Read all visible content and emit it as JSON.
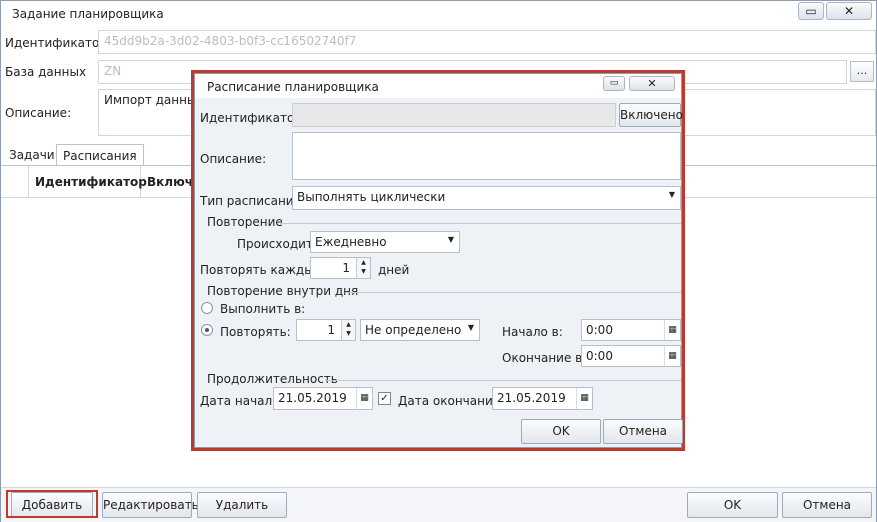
{
  "window": {
    "title": "Задание планировщика",
    "restore_icon": "▭",
    "close_icon": "✕"
  },
  "form": {
    "id_label": "Идентификатор:",
    "id_value": "45dd9b2a-3d02-4803-b0f3-cc16502740f7",
    "db_label": "База данных",
    "db_value": "ZN",
    "db_browse": "...",
    "desc_label": "Описание:",
    "desc_value": "Импорт данных"
  },
  "tabs": [
    {
      "label": "Задачи"
    },
    {
      "label": "Расписания"
    }
  ],
  "grid": {
    "columns": [
      "Идентификатор",
      "Включе"
    ]
  },
  "bottom": {
    "add": "Добавить",
    "edit": "Редактировать",
    "delete": "Удалить",
    "ok": "OK",
    "cancel": "Отмена"
  },
  "dialog": {
    "title": "Расписание планировщика",
    "restore_icon": "▭",
    "close_icon": "✕",
    "id_label": "Идентификатор:",
    "enabled_button": "Включено",
    "desc_label": "Описание:",
    "type_label": "Тип расписания:",
    "type_value": "Выполнять циклически",
    "repeat_group": "Повторение",
    "occurs_label": "Происходит:",
    "occurs_value": "Ежедневно",
    "every_label": "Повторять каждые:",
    "every_value": "1",
    "every_unit": "дней",
    "intraday_group": "Повторение внутри дня",
    "run_at_label": "Выполнить в:",
    "repeat_label": "Повторять:",
    "repeat_value": "1",
    "repeat_unit": "Не определено",
    "start_label": "Начало в:",
    "start_value": "0:00",
    "end_label": "Окончание в:",
    "end_value": "0:00",
    "duration_group": "Продолжительность",
    "date_start_label": "Дата начала:",
    "date_start_value": "21.05.2019",
    "date_end_label": "Дата окончания:",
    "date_end_value": "21.05.2019",
    "ok": "OK",
    "cancel": "Отмена"
  }
}
